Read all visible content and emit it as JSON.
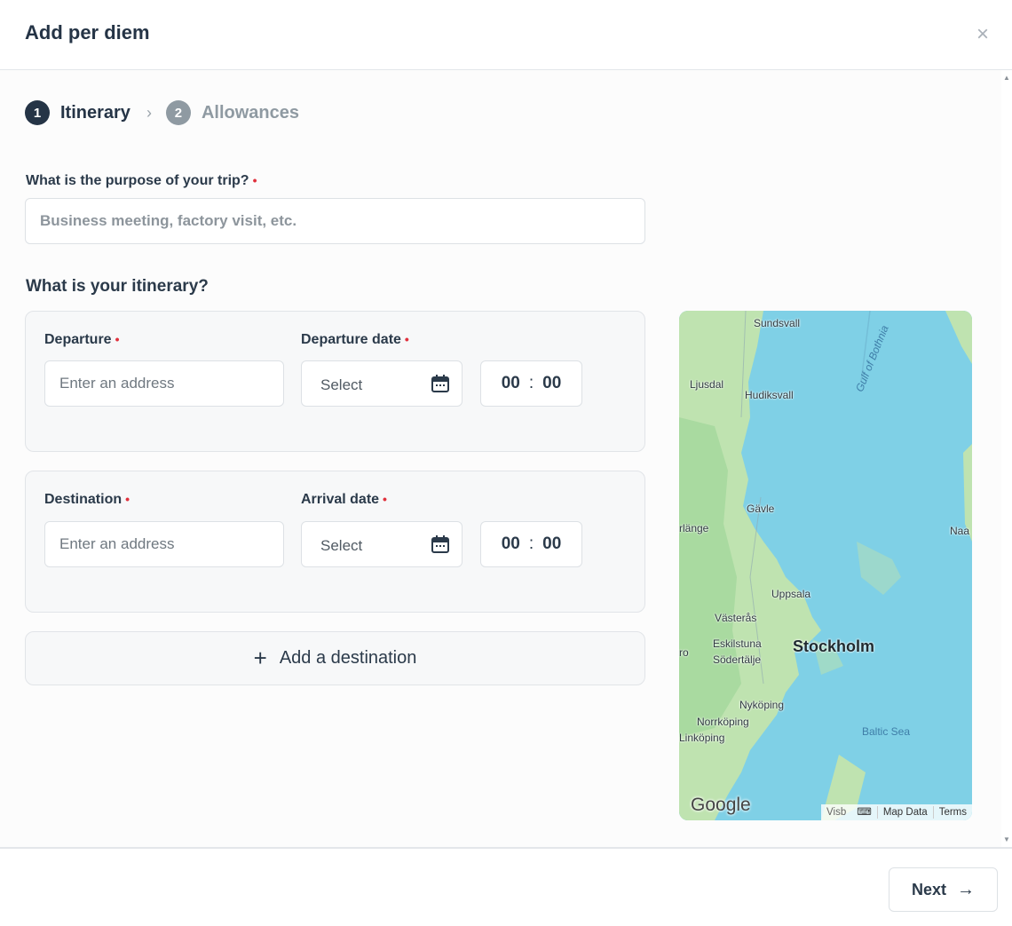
{
  "modal": {
    "title": "Add per diem",
    "close_icon": "close-icon"
  },
  "stepper": {
    "steps": [
      {
        "number": "1",
        "label": "Itinerary",
        "active": true
      },
      {
        "number": "2",
        "label": "Allowances",
        "active": false
      }
    ]
  },
  "purpose": {
    "label": "What is the purpose of your trip?",
    "required_mark": "•",
    "placeholder": "Business meeting, factory visit, etc.",
    "value": ""
  },
  "itinerary": {
    "title": "What is your itinerary?",
    "departure": {
      "address_label": "Departure",
      "address_placeholder": "Enter an address",
      "date_label": "Departure date",
      "date_placeholder": "Select",
      "hours": "00",
      "minutes": "00"
    },
    "destination": {
      "address_label": "Destination",
      "address_placeholder": "Enter an address",
      "date_label": "Arrival date",
      "date_placeholder": "Select",
      "hours": "00",
      "minutes": "00"
    },
    "add_destination_label": "Add a destination",
    "required_mark": "•"
  },
  "map": {
    "places": {
      "sundsvall": "Sundsvall",
      "ljusdal": "Ljusdal",
      "hudiksvall": "Hudiksvall",
      "gavle": "Gävle",
      "bollnas_partial": "rlänge",
      "naantali_partial": "Naa",
      "uppsala": "Uppsala",
      "vasteras": "Västerås",
      "eskilstuna": "Eskilstuna",
      "stockholm": "Stockholm",
      "orebro_partial": "ro",
      "sodertalje": "Södertälje",
      "nykoping": "Nyköping",
      "norrkoping": "Norrköping",
      "linkoping": "Linköping",
      "visby_partial": "Visb"
    },
    "water": {
      "gulf": "Gulf of Bothnia",
      "baltic": "Baltic Sea"
    },
    "logo": "Google",
    "footer": {
      "map_data": "Map Data",
      "terms": "Terms"
    },
    "colors": {
      "water": "#7fd0e6",
      "land": "#bfe3b0",
      "land_dark": "#8fcf8a"
    }
  },
  "footer": {
    "next_label": "Next",
    "next_icon": "arrow-right-icon"
  },
  "colors": {
    "primary": "#253446",
    "required": "#e0313d",
    "inactive_step": "#8f9aa2"
  }
}
